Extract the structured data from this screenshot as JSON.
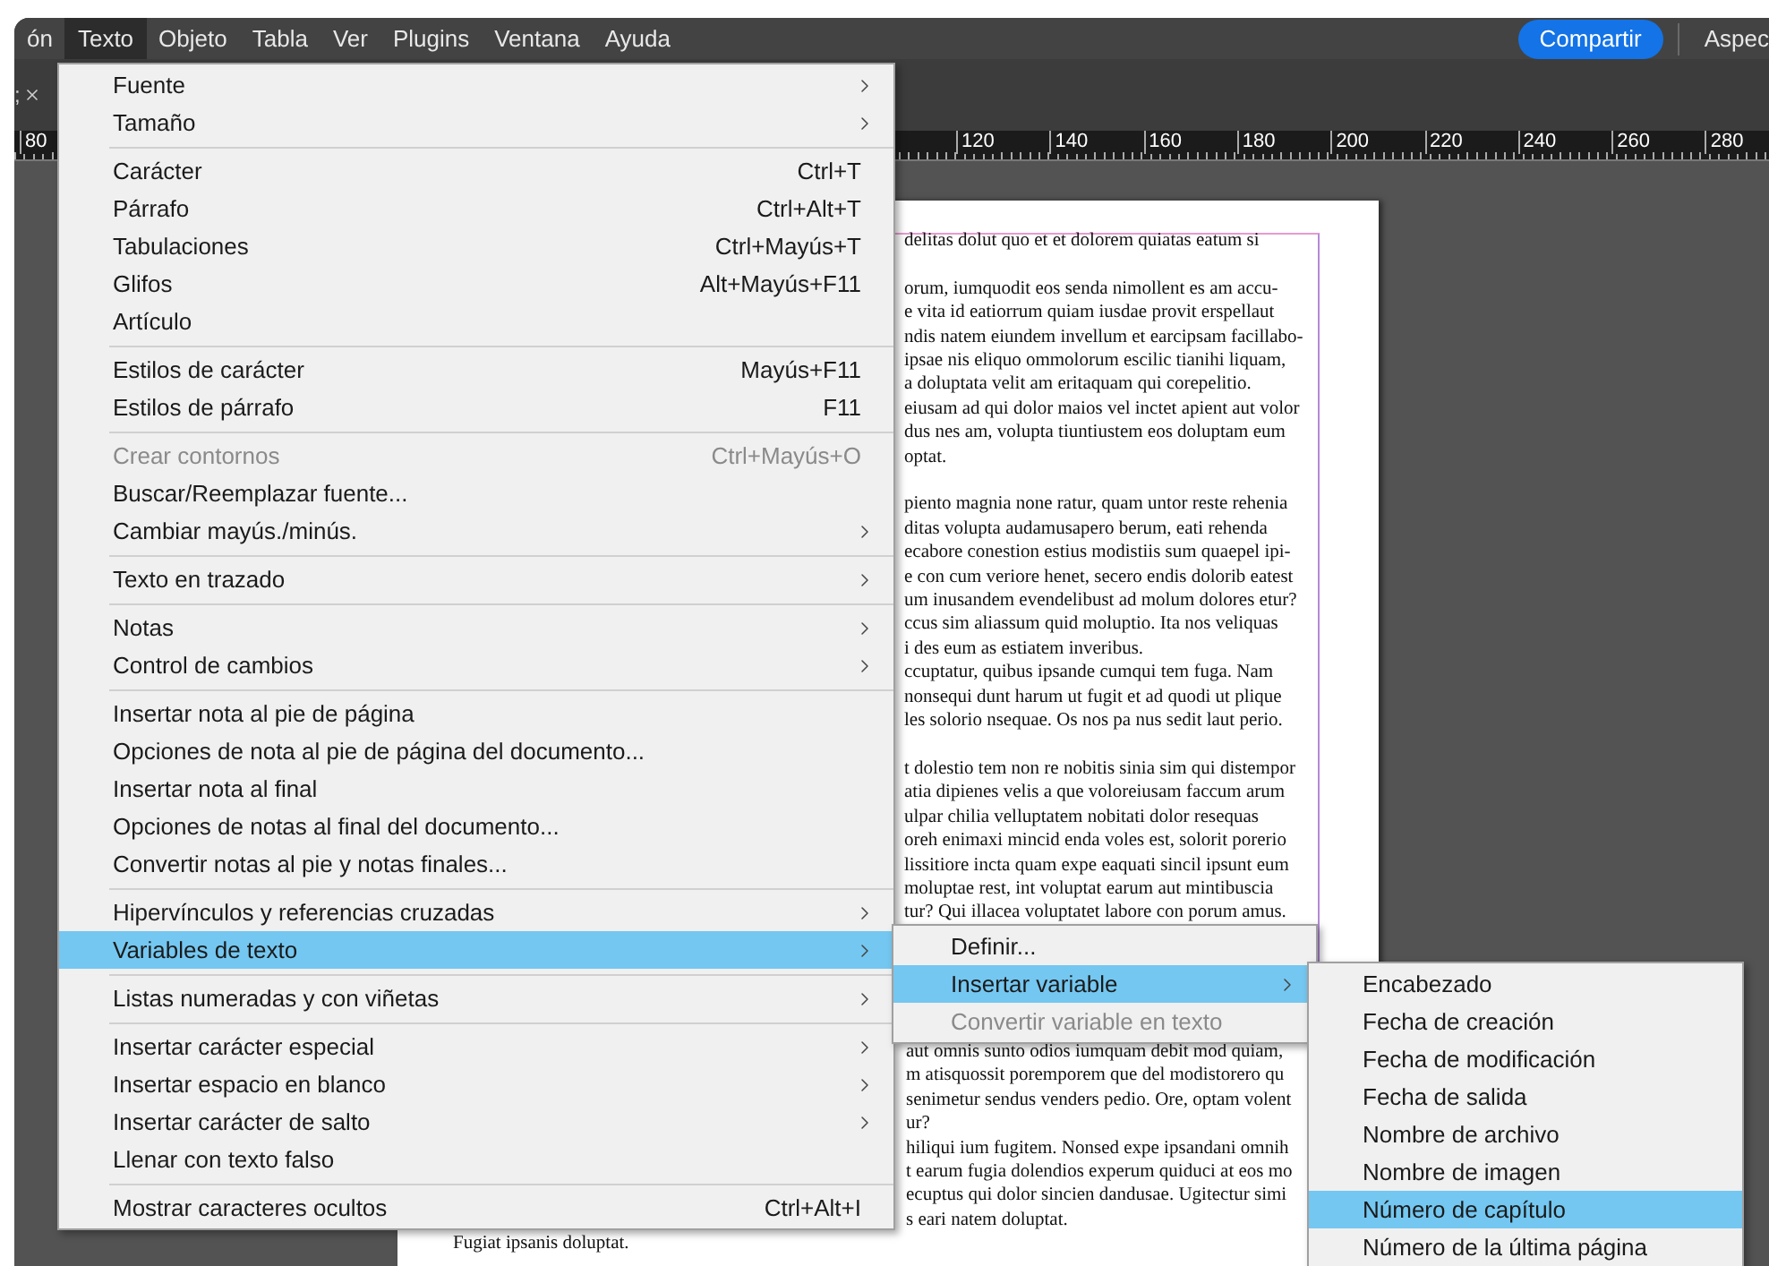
{
  "menubar": {
    "items": [
      {
        "label": "ón",
        "selected": false
      },
      {
        "label": "Texto",
        "selected": true
      },
      {
        "label": "Objeto",
        "selected": false
      },
      {
        "label": "Tabla",
        "selected": false
      },
      {
        "label": "Ver",
        "selected": false
      },
      {
        "label": "Plugins",
        "selected": false
      },
      {
        "label": "Ventana",
        "selected": false
      },
      {
        "label": "Ayuda",
        "selected": false
      }
    ],
    "share_button": "Compartir",
    "right_label": "Aspec"
  },
  "tab": {
    "label": ";"
  },
  "ruler": {
    "left_labels": [
      "80"
    ],
    "labels": [
      "120",
      "140",
      "160",
      "180",
      "200",
      "220",
      "240",
      "260",
      "280"
    ]
  },
  "document": {
    "upper_paragraphs": [
      [
        "delitas dolut quo et et dolorem quiatas eatum si"
      ],
      [
        "orum, iumquodit eos senda nimollent es am accu-",
        "e vita id eatiorrum quiam iusdae provit erspellaut",
        "ndis natem eiundem invellum et earcipsam facillabo-",
        "ipsae nis eliquo ommolorum escilic tianihi liquam,",
        "a doluptata velit am eritaquam qui corepelitio.",
        "eiusam ad qui dolor maios vel inctet apient aut volor",
        "dus nes am, volupta tiuntiustem eos doluptam eum",
        "optat."
      ],
      [
        "piento magnia none ratur, quam untor reste rehenia",
        "ditas volupta audamusapero berum, eati rehenda",
        "ecabore conestion estius modistiis sum quaepel ipi-",
        "e con cum veriore henet, secero endis dolorib eatest",
        "um inusandem evendelibust ad molum dolores etur?",
        "ccus sim aliassum quid moluptio. Ita nos veliquas",
        "i des eum as estiatem inveribus.",
        "ccuptatur, quibus ipsande cumqui tem fuga. Nam",
        "nonsequi dunt harum ut fugit et ad quodi ut plique",
        "les solorio nsequae. Os nos pa nus sedit laut perio."
      ],
      [
        "t dolestio tem non re nobitis sinia sim qui distempor",
        "atia dipienes velis a que voloreiusam faccum arum",
        "ulpar chilia velluptatem nobitati dolor resequas",
        "oreh enimaxi mincid enda voles est, solorit porerio",
        "lissitiore incta quam expe eaquati sincil ipsunt eum",
        "moluptae rest, int voluptat earum aut mintibuscia",
        "tur? Qui illacea voluptatet labore con porum amus."
      ]
    ],
    "lower_lines": [
      "aut omnis sunto odios iumquam debit mod quiam,",
      "m atisquossit poremporem que del modistorero qu",
      "senimetur sendus venders pedio. Ore, optam volent",
      "ur?",
      "hiliqui ium fugitem. Nonsed expe ipsandani omnih",
      "t earum fugia dolendios experum quiduci at eos mo",
      "ecuptus qui dolor sincien dandusae. Ugitectur simi",
      "s eari natem doluptat."
    ],
    "last_line": "Fugiat ipsanis doluptat."
  },
  "text_menu": {
    "items": [
      {
        "kind": "item",
        "label": "Fuente",
        "submenu": true,
        "disabled": false,
        "selected": false
      },
      {
        "kind": "item",
        "label": "Tamaño",
        "submenu": true,
        "disabled": false,
        "selected": false
      },
      {
        "kind": "separator"
      },
      {
        "kind": "item",
        "label": "Carácter",
        "shortcut": "Ctrl+T",
        "submenu": false,
        "disabled": false,
        "selected": false
      },
      {
        "kind": "item",
        "label": "Párrafo",
        "shortcut": "Ctrl+Alt+T",
        "submenu": false,
        "disabled": false,
        "selected": false
      },
      {
        "kind": "item",
        "label": "Tabulaciones",
        "shortcut": "Ctrl+Mayús+T",
        "submenu": false,
        "disabled": false,
        "selected": false
      },
      {
        "kind": "item",
        "label": "Glifos",
        "shortcut": "Alt+Mayús+F11",
        "submenu": false,
        "disabled": false,
        "selected": false
      },
      {
        "kind": "item",
        "label": "Artículo",
        "submenu": false,
        "disabled": false,
        "selected": false
      },
      {
        "kind": "separator"
      },
      {
        "kind": "item",
        "label": "Estilos de carácter",
        "shortcut": "Mayús+F11",
        "submenu": false,
        "disabled": false,
        "selected": false
      },
      {
        "kind": "item",
        "label": "Estilos de párrafo",
        "shortcut": "F11",
        "submenu": false,
        "disabled": false,
        "selected": false
      },
      {
        "kind": "separator"
      },
      {
        "kind": "item",
        "label": "Crear contornos",
        "shortcut": "Ctrl+Mayús+O",
        "submenu": false,
        "disabled": true,
        "selected": false
      },
      {
        "kind": "item",
        "label": "Buscar/Reemplazar fuente...",
        "submenu": false,
        "disabled": false,
        "selected": false
      },
      {
        "kind": "item",
        "label": "Cambiar mayús./minús.",
        "submenu": true,
        "disabled": false,
        "selected": false
      },
      {
        "kind": "separator"
      },
      {
        "kind": "item",
        "label": "Texto en trazado",
        "submenu": true,
        "disabled": false,
        "selected": false
      },
      {
        "kind": "separator"
      },
      {
        "kind": "item",
        "label": "Notas",
        "submenu": true,
        "disabled": false,
        "selected": false
      },
      {
        "kind": "item",
        "label": "Control de cambios",
        "submenu": true,
        "disabled": false,
        "selected": false
      },
      {
        "kind": "separator"
      },
      {
        "kind": "item",
        "label": "Insertar nota al pie de página",
        "submenu": false,
        "disabled": false,
        "selected": false
      },
      {
        "kind": "item",
        "label": "Opciones de nota al pie de página del documento...",
        "submenu": false,
        "disabled": false,
        "selected": false
      },
      {
        "kind": "item",
        "label": "Insertar nota al final",
        "submenu": false,
        "disabled": false,
        "selected": false
      },
      {
        "kind": "item",
        "label": "Opciones de notas al final del documento...",
        "submenu": false,
        "disabled": false,
        "selected": false
      },
      {
        "kind": "item",
        "label": "Convertir notas al pie y notas finales...",
        "submenu": false,
        "disabled": false,
        "selected": false
      },
      {
        "kind": "separator"
      },
      {
        "kind": "item",
        "label": "Hipervínculos y referencias cruzadas",
        "submenu": true,
        "disabled": false,
        "selected": false
      },
      {
        "kind": "item",
        "label": "Variables de texto",
        "submenu": true,
        "disabled": false,
        "selected": true
      },
      {
        "kind": "separator"
      },
      {
        "kind": "item",
        "label": "Listas numeradas y con viñetas",
        "submenu": true,
        "disabled": false,
        "selected": false
      },
      {
        "kind": "separator"
      },
      {
        "kind": "item",
        "label": "Insertar carácter especial",
        "submenu": true,
        "disabled": false,
        "selected": false
      },
      {
        "kind": "item",
        "label": "Insertar espacio en blanco",
        "submenu": true,
        "disabled": false,
        "selected": false
      },
      {
        "kind": "item",
        "label": "Insertar carácter de salto",
        "submenu": true,
        "disabled": false,
        "selected": false
      },
      {
        "kind": "item",
        "label": "Llenar con texto falso",
        "submenu": false,
        "disabled": false,
        "selected": false
      },
      {
        "kind": "separator"
      },
      {
        "kind": "item",
        "label": "Mostrar caracteres ocultos",
        "shortcut": "Ctrl+Alt+I",
        "submenu": false,
        "disabled": false,
        "selected": false
      }
    ]
  },
  "variables_menu": {
    "items": [
      {
        "kind": "item",
        "label": "Definir...",
        "submenu": false,
        "disabled": false,
        "selected": false
      },
      {
        "kind": "item",
        "label": "Insertar variable",
        "submenu": true,
        "disabled": false,
        "selected": true
      },
      {
        "kind": "item",
        "label": "Convertir variable en texto",
        "submenu": false,
        "disabled": true,
        "selected": false
      }
    ]
  },
  "insert_variable_menu": {
    "items": [
      {
        "kind": "item",
        "label": "Encabezado",
        "submenu": false,
        "disabled": false,
        "selected": false
      },
      {
        "kind": "item",
        "label": "Fecha de creación",
        "submenu": false,
        "disabled": false,
        "selected": false
      },
      {
        "kind": "item",
        "label": "Fecha de modificación",
        "submenu": false,
        "disabled": false,
        "selected": false
      },
      {
        "kind": "item",
        "label": "Fecha de salida",
        "submenu": false,
        "disabled": false,
        "selected": false
      },
      {
        "kind": "item",
        "label": "Nombre de archivo",
        "submenu": false,
        "disabled": false,
        "selected": false
      },
      {
        "kind": "item",
        "label": "Nombre de imagen",
        "submenu": false,
        "disabled": false,
        "selected": false
      },
      {
        "kind": "item",
        "label": "Número de capítulo",
        "submenu": false,
        "disabled": false,
        "selected": true
      },
      {
        "kind": "item",
        "label": "Número de la última página",
        "submenu": false,
        "disabled": false,
        "selected": false
      }
    ]
  }
}
